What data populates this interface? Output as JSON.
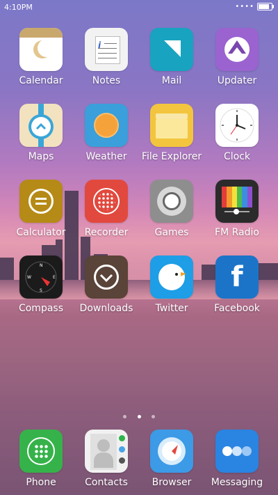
{
  "status": {
    "time": "4:10PM",
    "signal": "••••"
  },
  "apps": [
    {
      "label": "Calendar"
    },
    {
      "label": "Notes"
    },
    {
      "label": "Mail"
    },
    {
      "label": "Updater"
    },
    {
      "label": "Maps"
    },
    {
      "label": "Weather"
    },
    {
      "label": "File Explorer"
    },
    {
      "label": "Clock"
    },
    {
      "label": "Calculator"
    },
    {
      "label": "Recorder"
    },
    {
      "label": "Games"
    },
    {
      "label": "FM Radio"
    },
    {
      "label": "Compass"
    },
    {
      "label": "Downloads"
    },
    {
      "label": "Twitter"
    },
    {
      "label": "Facebook"
    }
  ],
  "dock": [
    {
      "label": "Phone"
    },
    {
      "label": "Contacts"
    },
    {
      "label": "Browser"
    },
    {
      "label": "Messaging"
    }
  ],
  "pager": {
    "pages": 3,
    "current": 2
  },
  "colors": {
    "accent": "#ffffff"
  }
}
